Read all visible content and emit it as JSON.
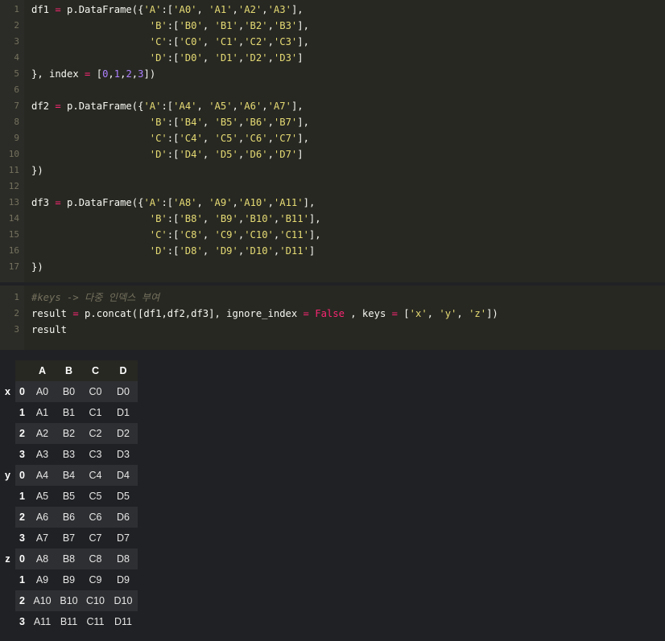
{
  "cell1": {
    "line_numbers": [
      "1",
      "2",
      "3",
      "4",
      "5",
      "6",
      "7",
      "8",
      "9",
      "10",
      "11",
      "12",
      "13",
      "14",
      "15",
      "16",
      "17"
    ],
    "lines": [
      [
        [
          "p",
          "df1 "
        ],
        [
          "o",
          "="
        ],
        [
          "p",
          " p.DataFrame({"
        ],
        [
          "s",
          "'A'"
        ],
        [
          "p",
          ":["
        ],
        [
          "s",
          "'A0'"
        ],
        [
          "p",
          ", "
        ],
        [
          "s",
          "'A1'"
        ],
        [
          "p",
          ","
        ],
        [
          "s",
          "'A2'"
        ],
        [
          "p",
          ","
        ],
        [
          "s",
          "'A3'"
        ],
        [
          "p",
          "],"
        ]
      ],
      [
        [
          "p",
          "                    "
        ],
        [
          "s",
          "'B'"
        ],
        [
          "p",
          ":["
        ],
        [
          "s",
          "'B0'"
        ],
        [
          "p",
          ", "
        ],
        [
          "s",
          "'B1'"
        ],
        [
          "p",
          ","
        ],
        [
          "s",
          "'B2'"
        ],
        [
          "p",
          ","
        ],
        [
          "s",
          "'B3'"
        ],
        [
          "p",
          "],"
        ]
      ],
      [
        [
          "p",
          "                    "
        ],
        [
          "s",
          "'C'"
        ],
        [
          "p",
          ":["
        ],
        [
          "s",
          "'C0'"
        ],
        [
          "p",
          ", "
        ],
        [
          "s",
          "'C1'"
        ],
        [
          "p",
          ","
        ],
        [
          "s",
          "'C2'"
        ],
        [
          "p",
          ","
        ],
        [
          "s",
          "'C3'"
        ],
        [
          "p",
          "],"
        ]
      ],
      [
        [
          "p",
          "                    "
        ],
        [
          "s",
          "'D'"
        ],
        [
          "p",
          ":["
        ],
        [
          "s",
          "'D0'"
        ],
        [
          "p",
          ", "
        ],
        [
          "s",
          "'D1'"
        ],
        [
          "p",
          ","
        ],
        [
          "s",
          "'D2'"
        ],
        [
          "p",
          ","
        ],
        [
          "s",
          "'D3'"
        ],
        [
          "p",
          "]"
        ]
      ],
      [
        [
          "p",
          "}, index "
        ],
        [
          "o",
          "="
        ],
        [
          "p",
          " ["
        ],
        [
          "n",
          "0"
        ],
        [
          "p",
          ","
        ],
        [
          "n",
          "1"
        ],
        [
          "p",
          ","
        ],
        [
          "n",
          "2"
        ],
        [
          "p",
          ","
        ],
        [
          "n",
          "3"
        ],
        [
          "p",
          "])"
        ]
      ],
      [],
      [
        [
          "p",
          "df2 "
        ],
        [
          "o",
          "="
        ],
        [
          "p",
          " p.DataFrame({"
        ],
        [
          "s",
          "'A'"
        ],
        [
          "p",
          ":["
        ],
        [
          "s",
          "'A4'"
        ],
        [
          "p",
          ", "
        ],
        [
          "s",
          "'A5'"
        ],
        [
          "p",
          ","
        ],
        [
          "s",
          "'A6'"
        ],
        [
          "p",
          ","
        ],
        [
          "s",
          "'A7'"
        ],
        [
          "p",
          "],"
        ]
      ],
      [
        [
          "p",
          "                    "
        ],
        [
          "s",
          "'B'"
        ],
        [
          "p",
          ":["
        ],
        [
          "s",
          "'B4'"
        ],
        [
          "p",
          ", "
        ],
        [
          "s",
          "'B5'"
        ],
        [
          "p",
          ","
        ],
        [
          "s",
          "'B6'"
        ],
        [
          "p",
          ","
        ],
        [
          "s",
          "'B7'"
        ],
        [
          "p",
          "],"
        ]
      ],
      [
        [
          "p",
          "                    "
        ],
        [
          "s",
          "'C'"
        ],
        [
          "p",
          ":["
        ],
        [
          "s",
          "'C4'"
        ],
        [
          "p",
          ", "
        ],
        [
          "s",
          "'C5'"
        ],
        [
          "p",
          ","
        ],
        [
          "s",
          "'C6'"
        ],
        [
          "p",
          ","
        ],
        [
          "s",
          "'C7'"
        ],
        [
          "p",
          "],"
        ]
      ],
      [
        [
          "p",
          "                    "
        ],
        [
          "s",
          "'D'"
        ],
        [
          "p",
          ":["
        ],
        [
          "s",
          "'D4'"
        ],
        [
          "p",
          ", "
        ],
        [
          "s",
          "'D5'"
        ],
        [
          "p",
          ","
        ],
        [
          "s",
          "'D6'"
        ],
        [
          "p",
          ","
        ],
        [
          "s",
          "'D7'"
        ],
        [
          "p",
          "]"
        ]
      ],
      [
        [
          "p",
          "})"
        ]
      ],
      [],
      [
        [
          "p",
          "df3 "
        ],
        [
          "o",
          "="
        ],
        [
          "p",
          " p.DataFrame({"
        ],
        [
          "s",
          "'A'"
        ],
        [
          "p",
          ":["
        ],
        [
          "s",
          "'A8'"
        ],
        [
          "p",
          ", "
        ],
        [
          "s",
          "'A9'"
        ],
        [
          "p",
          ","
        ],
        [
          "s",
          "'A10'"
        ],
        [
          "p",
          ","
        ],
        [
          "s",
          "'A11'"
        ],
        [
          "p",
          "],"
        ]
      ],
      [
        [
          "p",
          "                    "
        ],
        [
          "s",
          "'B'"
        ],
        [
          "p",
          ":["
        ],
        [
          "s",
          "'B8'"
        ],
        [
          "p",
          ", "
        ],
        [
          "s",
          "'B9'"
        ],
        [
          "p",
          ","
        ],
        [
          "s",
          "'B10'"
        ],
        [
          "p",
          ","
        ],
        [
          "s",
          "'B11'"
        ],
        [
          "p",
          "],"
        ]
      ],
      [
        [
          "p",
          "                    "
        ],
        [
          "s",
          "'C'"
        ],
        [
          "p",
          ":["
        ],
        [
          "s",
          "'C8'"
        ],
        [
          "p",
          ", "
        ],
        [
          "s",
          "'C9'"
        ],
        [
          "p",
          ","
        ],
        [
          "s",
          "'C10'"
        ],
        [
          "p",
          ","
        ],
        [
          "s",
          "'C11'"
        ],
        [
          "p",
          "],"
        ]
      ],
      [
        [
          "p",
          "                    "
        ],
        [
          "s",
          "'D'"
        ],
        [
          "p",
          ":["
        ],
        [
          "s",
          "'D8'"
        ],
        [
          "p",
          ", "
        ],
        [
          "s",
          "'D9'"
        ],
        [
          "p",
          ","
        ],
        [
          "s",
          "'D10'"
        ],
        [
          "p",
          ","
        ],
        [
          "s",
          "'D11'"
        ],
        [
          "p",
          "]"
        ]
      ],
      [
        [
          "p",
          "})"
        ]
      ]
    ]
  },
  "cell2": {
    "line_numbers": [
      "1",
      "2",
      "3"
    ],
    "lines": [
      [
        [
          "c",
          "#keys -> 다중 인덱스 부여"
        ]
      ],
      [
        [
          "p",
          "result "
        ],
        [
          "o",
          "="
        ],
        [
          "p",
          " p.concat([df1,df2,df3], ignore_index "
        ],
        [
          "o",
          "="
        ],
        [
          "p",
          " "
        ],
        [
          "k",
          "False"
        ],
        [
          "p",
          " , keys "
        ],
        [
          "o",
          "="
        ],
        [
          "p",
          " ["
        ],
        [
          "s",
          "'x'"
        ],
        [
          "p",
          ", "
        ],
        [
          "s",
          "'y'"
        ],
        [
          "p",
          ", "
        ],
        [
          "s",
          "'z'"
        ],
        [
          "p",
          "])"
        ]
      ],
      [
        [
          "p",
          "result"
        ]
      ]
    ]
  },
  "table": {
    "columns": [
      "A",
      "B",
      "C",
      "D"
    ],
    "rows": [
      {
        "key": "x",
        "idx": "0",
        "values": [
          "A0",
          "B0",
          "C0",
          "D0"
        ]
      },
      {
        "key": "",
        "idx": "1",
        "values": [
          "A1",
          "B1",
          "C1",
          "D1"
        ]
      },
      {
        "key": "",
        "idx": "2",
        "values": [
          "A2",
          "B2",
          "C2",
          "D2"
        ]
      },
      {
        "key": "",
        "idx": "3",
        "values": [
          "A3",
          "B3",
          "C3",
          "D3"
        ]
      },
      {
        "key": "y",
        "idx": "0",
        "values": [
          "A4",
          "B4",
          "C4",
          "D4"
        ]
      },
      {
        "key": "",
        "idx": "1",
        "values": [
          "A5",
          "B5",
          "C5",
          "D5"
        ]
      },
      {
        "key": "",
        "idx": "2",
        "values": [
          "A6",
          "B6",
          "C6",
          "D6"
        ]
      },
      {
        "key": "",
        "idx": "3",
        "values": [
          "A7",
          "B7",
          "C7",
          "D7"
        ]
      },
      {
        "key": "z",
        "idx": "0",
        "values": [
          "A8",
          "B8",
          "C8",
          "D8"
        ]
      },
      {
        "key": "",
        "idx": "1",
        "values": [
          "A9",
          "B9",
          "C9",
          "D9"
        ]
      },
      {
        "key": "",
        "idx": "2",
        "values": [
          "A10",
          "B10",
          "C10",
          "D10"
        ]
      },
      {
        "key": "",
        "idx": "3",
        "values": [
          "A11",
          "B11",
          "C11",
          "D11"
        ]
      }
    ]
  }
}
